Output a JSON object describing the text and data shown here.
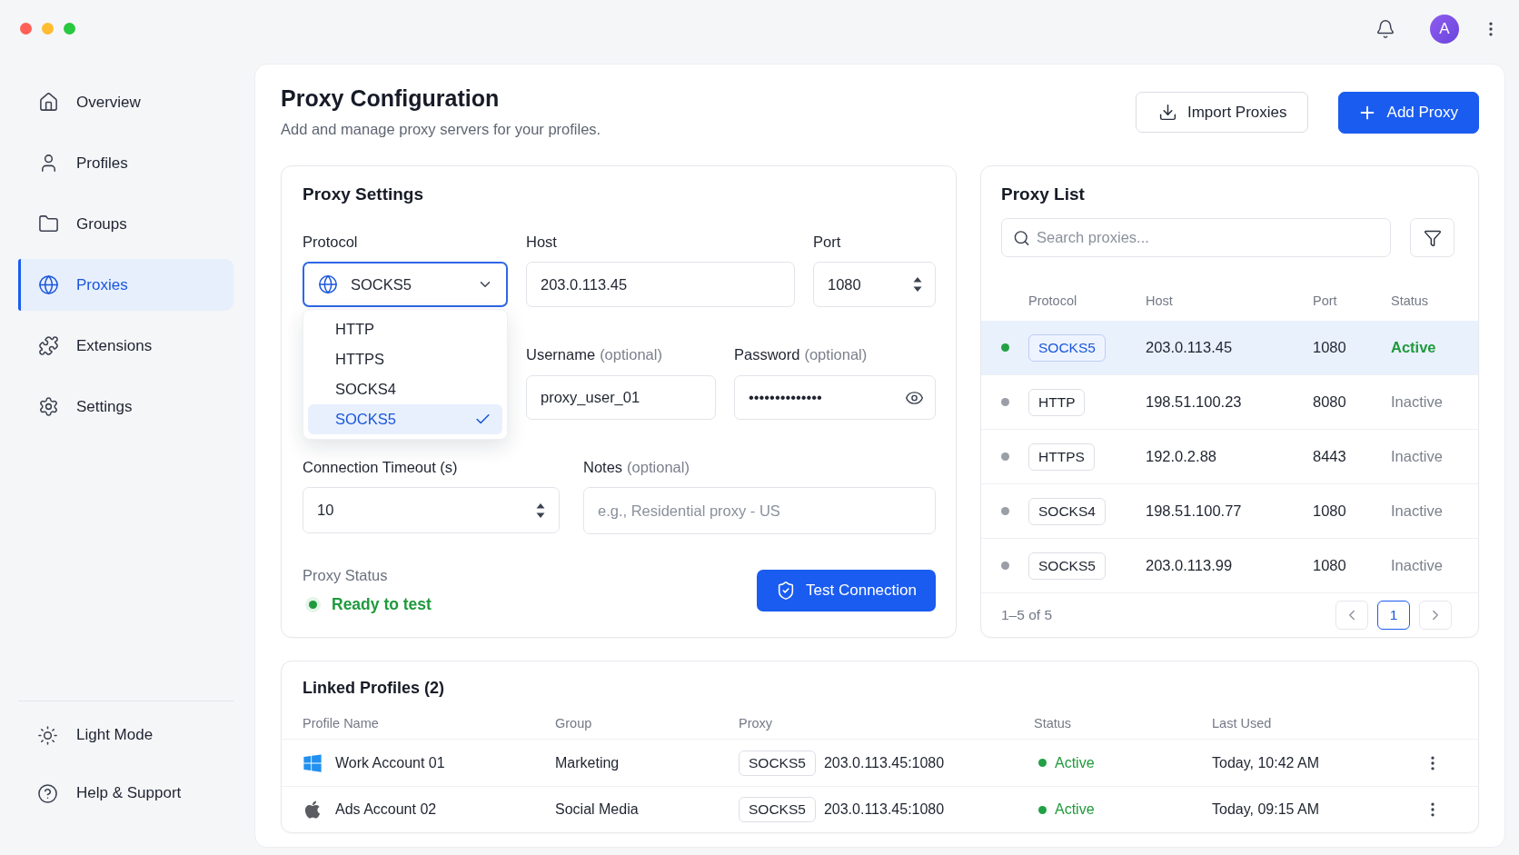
{
  "sidebar": {
    "items": [
      {
        "label": "Overview",
        "selected": false
      },
      {
        "label": "Profiles",
        "selected": false
      },
      {
        "label": "Groups",
        "selected": false
      },
      {
        "label": "Proxies",
        "selected": true
      },
      {
        "label": "Extensions",
        "selected": false
      },
      {
        "label": "Settings",
        "selected": false
      }
    ],
    "footer_items": [
      {
        "label": "Light Mode"
      },
      {
        "label": "Help & Support"
      }
    ]
  },
  "top_bar": {
    "avatar": {
      "initial": "A"
    }
  },
  "header": {
    "title": "Proxy Configuration",
    "subtitle": "Add and manage proxy servers for your profiles.",
    "buttons": [
      {
        "label": "Import Proxies",
        "kind": "secondary"
      },
      {
        "label": "Add Proxy",
        "kind": "primary"
      }
    ]
  },
  "proxy_settings": {
    "title": "Proxy Settings",
    "protocol": {
      "label": "Protocol",
      "value": "SOCKS5",
      "expanded": true,
      "options": [
        {
          "label": "HTTP",
          "selected": false
        },
        {
          "label": "HTTPS",
          "selected": false
        },
        {
          "label": "SOCKS4",
          "selected": false
        },
        {
          "label": "SOCKS5",
          "selected": true
        }
      ]
    },
    "host": {
      "label": "Host",
      "value": "203.0.113.45"
    },
    "port": {
      "label": "Port",
      "value": "1080"
    },
    "username": {
      "label": "Username",
      "hint": "(optional)",
      "value": "proxy_user_01"
    },
    "password": {
      "label": "Password",
      "hint": "(optional)",
      "value": "••••••••••••••"
    },
    "timeout": {
      "label": "Connection Timeout (s)",
      "value": "10"
    },
    "notes": {
      "label": "Notes",
      "hint": "(optional)",
      "placeholder": "e.g., Residential proxy - US"
    },
    "status": {
      "label": "Proxy Status",
      "value": "Ready to test"
    },
    "test_button": "Test Connection"
  },
  "proxy_list": {
    "title": "Proxy List",
    "search": {
      "placeholder": "Search proxies..."
    },
    "columns": [
      "Protocol",
      "Host",
      "Port",
      "Status"
    ],
    "rows": [
      {
        "protocol": "SOCKS5",
        "host": "203.0.113.45",
        "port": "1080",
        "status": "Active",
        "active": true,
        "selected": true
      },
      {
        "protocol": "HTTP",
        "host": "198.51.100.23",
        "port": "8080",
        "status": "Inactive",
        "active": false,
        "selected": false
      },
      {
        "protocol": "HTTPS",
        "host": "192.0.2.88",
        "port": "8443",
        "status": "Inactive",
        "active": false,
        "selected": false
      },
      {
        "protocol": "SOCKS4",
        "host": "198.51.100.77",
        "port": "1080",
        "status": "Inactive",
        "active": false,
        "selected": false
      },
      {
        "protocol": "SOCKS5",
        "host": "203.0.113.99",
        "port": "1080",
        "status": "Inactive",
        "active": false,
        "selected": false
      }
    ],
    "range": "1–5 of 5",
    "pages": [
      {
        "label": "1",
        "selected": true
      }
    ]
  },
  "linked_profiles": {
    "title": "Linked Profiles (2)",
    "columns": [
      "Profile Name",
      "Group",
      "Proxy",
      "Status",
      "Last Used"
    ],
    "rows": [
      {
        "kind": "windows",
        "name": "Work Account 01",
        "group": "Marketing",
        "protocol": "SOCKS5",
        "address": "203.0.113.45:1080",
        "status": "Active",
        "active": true,
        "last_used": "Today, 10:42 AM"
      },
      {
        "kind": "apple",
        "name": "Ads Account 02",
        "group": "Social Media",
        "protocol": "SOCKS5",
        "address": "203.0.113.45:1080",
        "status": "Active",
        "active": true,
        "last_used": "Today, 09:15 AM"
      }
    ]
  }
}
